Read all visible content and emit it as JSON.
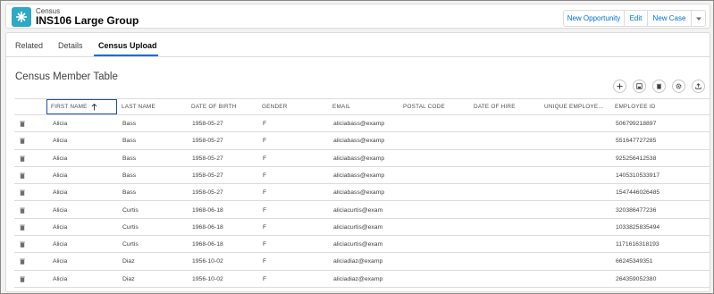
{
  "header": {
    "object_type": "Census",
    "record_title": "INS106 Large Group",
    "buttons": {
      "new_opportunity": "New Opportunity",
      "edit": "Edit",
      "new_case": "New Case"
    }
  },
  "tabs": [
    {
      "label": "Related"
    },
    {
      "label": "Details"
    },
    {
      "label": "Census Upload",
      "active": true
    }
  ],
  "table": {
    "title": "Census Member Table",
    "toolbar_icons": [
      "add-icon",
      "save-icon",
      "delete-icon",
      "settings-icon",
      "upload-icon"
    ],
    "columns": [
      "FIRST NAME",
      "LAST NAME",
      "DATE OF BIRTH",
      "GENDER",
      "EMAIL",
      "POSTAL CODE",
      "DATE OF HIRE",
      "UNIQUE EMPLOYE...",
      "EMPLOYEE ID"
    ],
    "sorted_column": "FIRST NAME",
    "rows": [
      {
        "first": "Alicia",
        "last": "Bass",
        "dob": "1958-05-27",
        "gender": "F",
        "email": "aliciabass@examp",
        "postal": "",
        "hire": "",
        "unique": "",
        "empid": "506799218897"
      },
      {
        "first": "Alicia",
        "last": "Bass",
        "dob": "1958-05-27",
        "gender": "F",
        "email": "aliciabass@examp",
        "postal": "",
        "hire": "",
        "unique": "",
        "empid": "551647727285"
      },
      {
        "first": "Alicia",
        "last": "Bass",
        "dob": "1958-05-27",
        "gender": "F",
        "email": "aliciabass@examp",
        "postal": "",
        "hire": "",
        "unique": "",
        "empid": "925256412538"
      },
      {
        "first": "Alicia",
        "last": "Bass",
        "dob": "1958-05-27",
        "gender": "F",
        "email": "aliciabass@examp",
        "postal": "",
        "hire": "",
        "unique": "",
        "empid": "1405310533917"
      },
      {
        "first": "Alicia",
        "last": "Bass",
        "dob": "1958-05-27",
        "gender": "F",
        "email": "aliciabass@examp",
        "postal": "",
        "hire": "",
        "unique": "",
        "empid": "1547446026485"
      },
      {
        "first": "Alicia",
        "last": "Curtis",
        "dob": "1968-06-18",
        "gender": "F",
        "email": "aliciacurtis@exam",
        "postal": "",
        "hire": "",
        "unique": "",
        "empid": "320386477236"
      },
      {
        "first": "Alicia",
        "last": "Curtis",
        "dob": "1968-06-18",
        "gender": "F",
        "email": "aliciacurtis@exam",
        "postal": "",
        "hire": "",
        "unique": "",
        "empid": "1033825835494"
      },
      {
        "first": "Alicia",
        "last": "Curtis",
        "dob": "1968-06-18",
        "gender": "F",
        "email": "aliciacurtis@exam",
        "postal": "",
        "hire": "",
        "unique": "",
        "empid": "1171616318193"
      },
      {
        "first": "Alicia",
        "last": "Diaz",
        "dob": "1956-10-02",
        "gender": "F",
        "email": "aliciadiaz@examp",
        "postal": "",
        "hire": "",
        "unique": "",
        "empid": "66245349351"
      },
      {
        "first": "Alicia",
        "last": "Diaz",
        "dob": "1956-10-02",
        "gender": "F",
        "email": "aliciadiaz@examp",
        "postal": "",
        "hire": "",
        "unique": "",
        "empid": "264359052380"
      }
    ]
  },
  "colors": {
    "brand_blue": "#0070d2",
    "record_icon": "#2ea8c4",
    "active_header_border": "#1b5297"
  }
}
